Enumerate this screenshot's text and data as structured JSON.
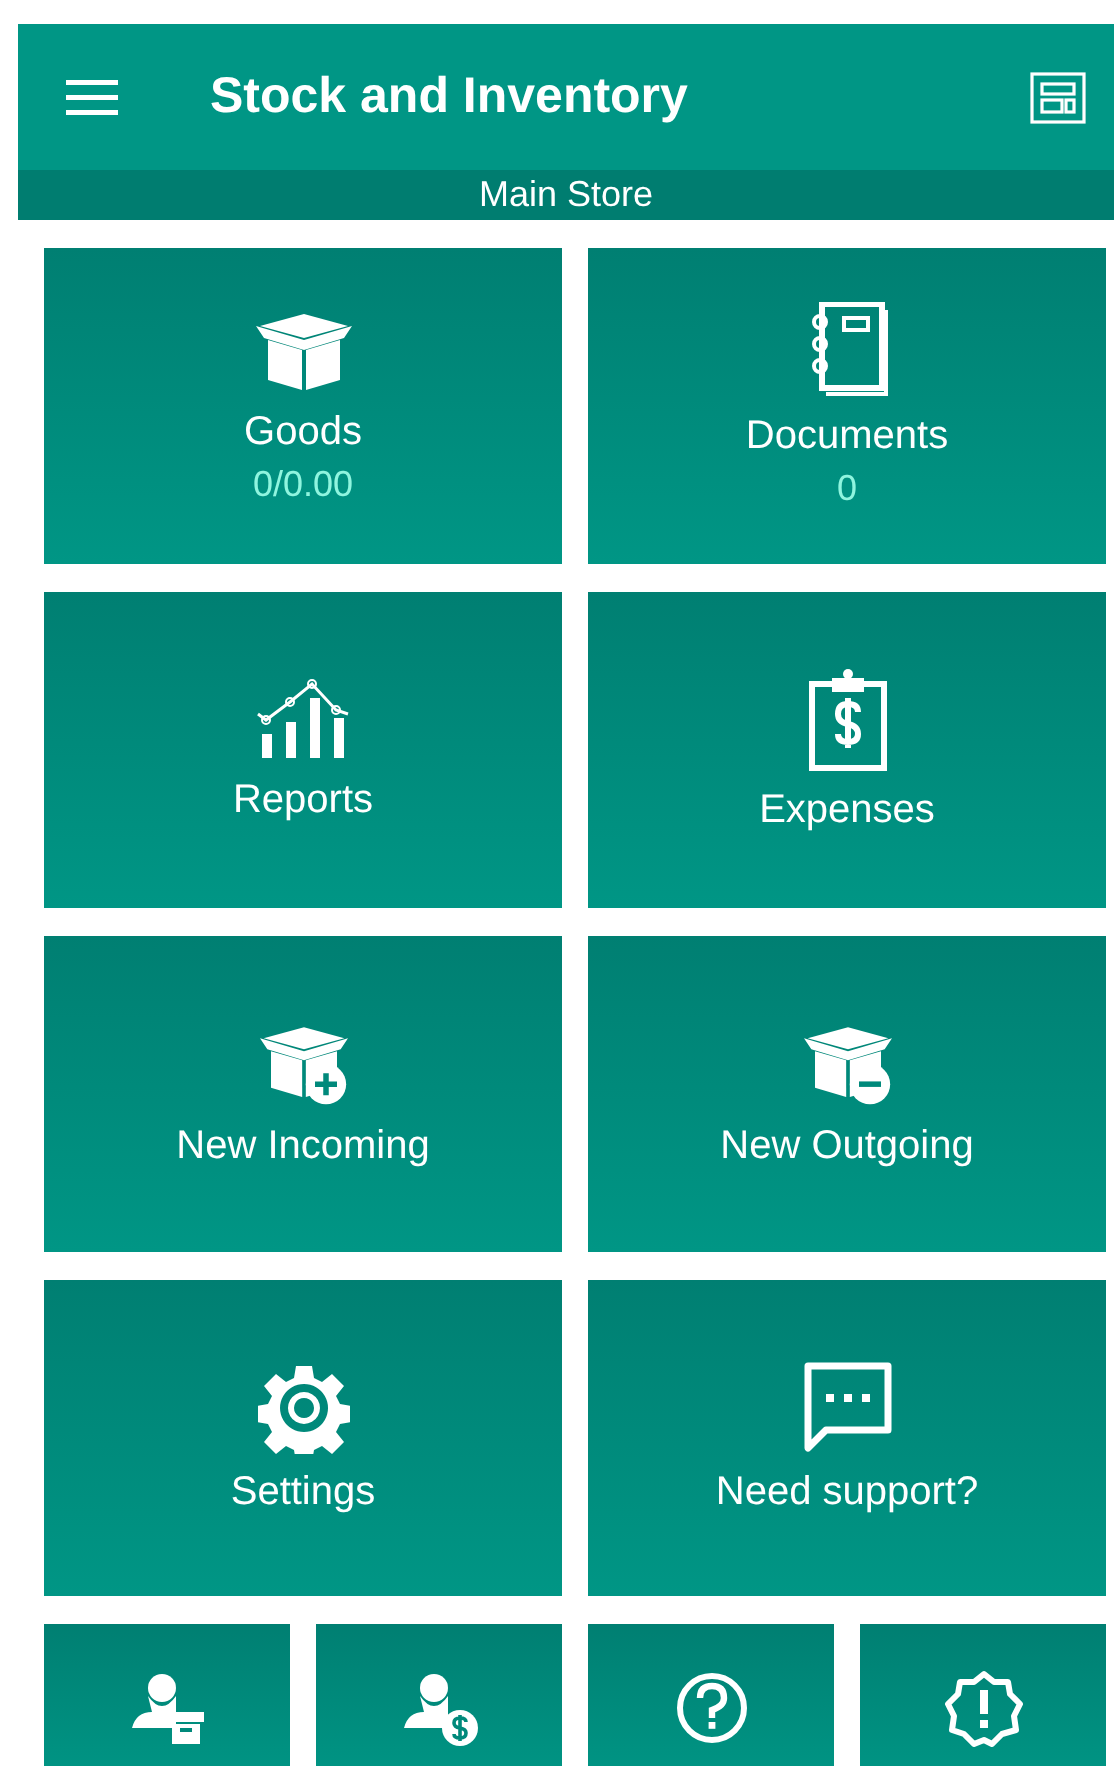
{
  "app_bar": {
    "title": "Stock and Inventory"
  },
  "store_bar": {
    "name": "Main Store"
  },
  "tiles": [
    {
      "label": "Goods",
      "value": "0/0.00"
    },
    {
      "label": "Documents",
      "value": "0"
    },
    {
      "label": "Reports"
    },
    {
      "label": "Expenses"
    },
    {
      "label": "New Incoming"
    },
    {
      "label": "New Outgoing"
    },
    {
      "label": "Settings"
    },
    {
      "label": "Need support?"
    }
  ]
}
